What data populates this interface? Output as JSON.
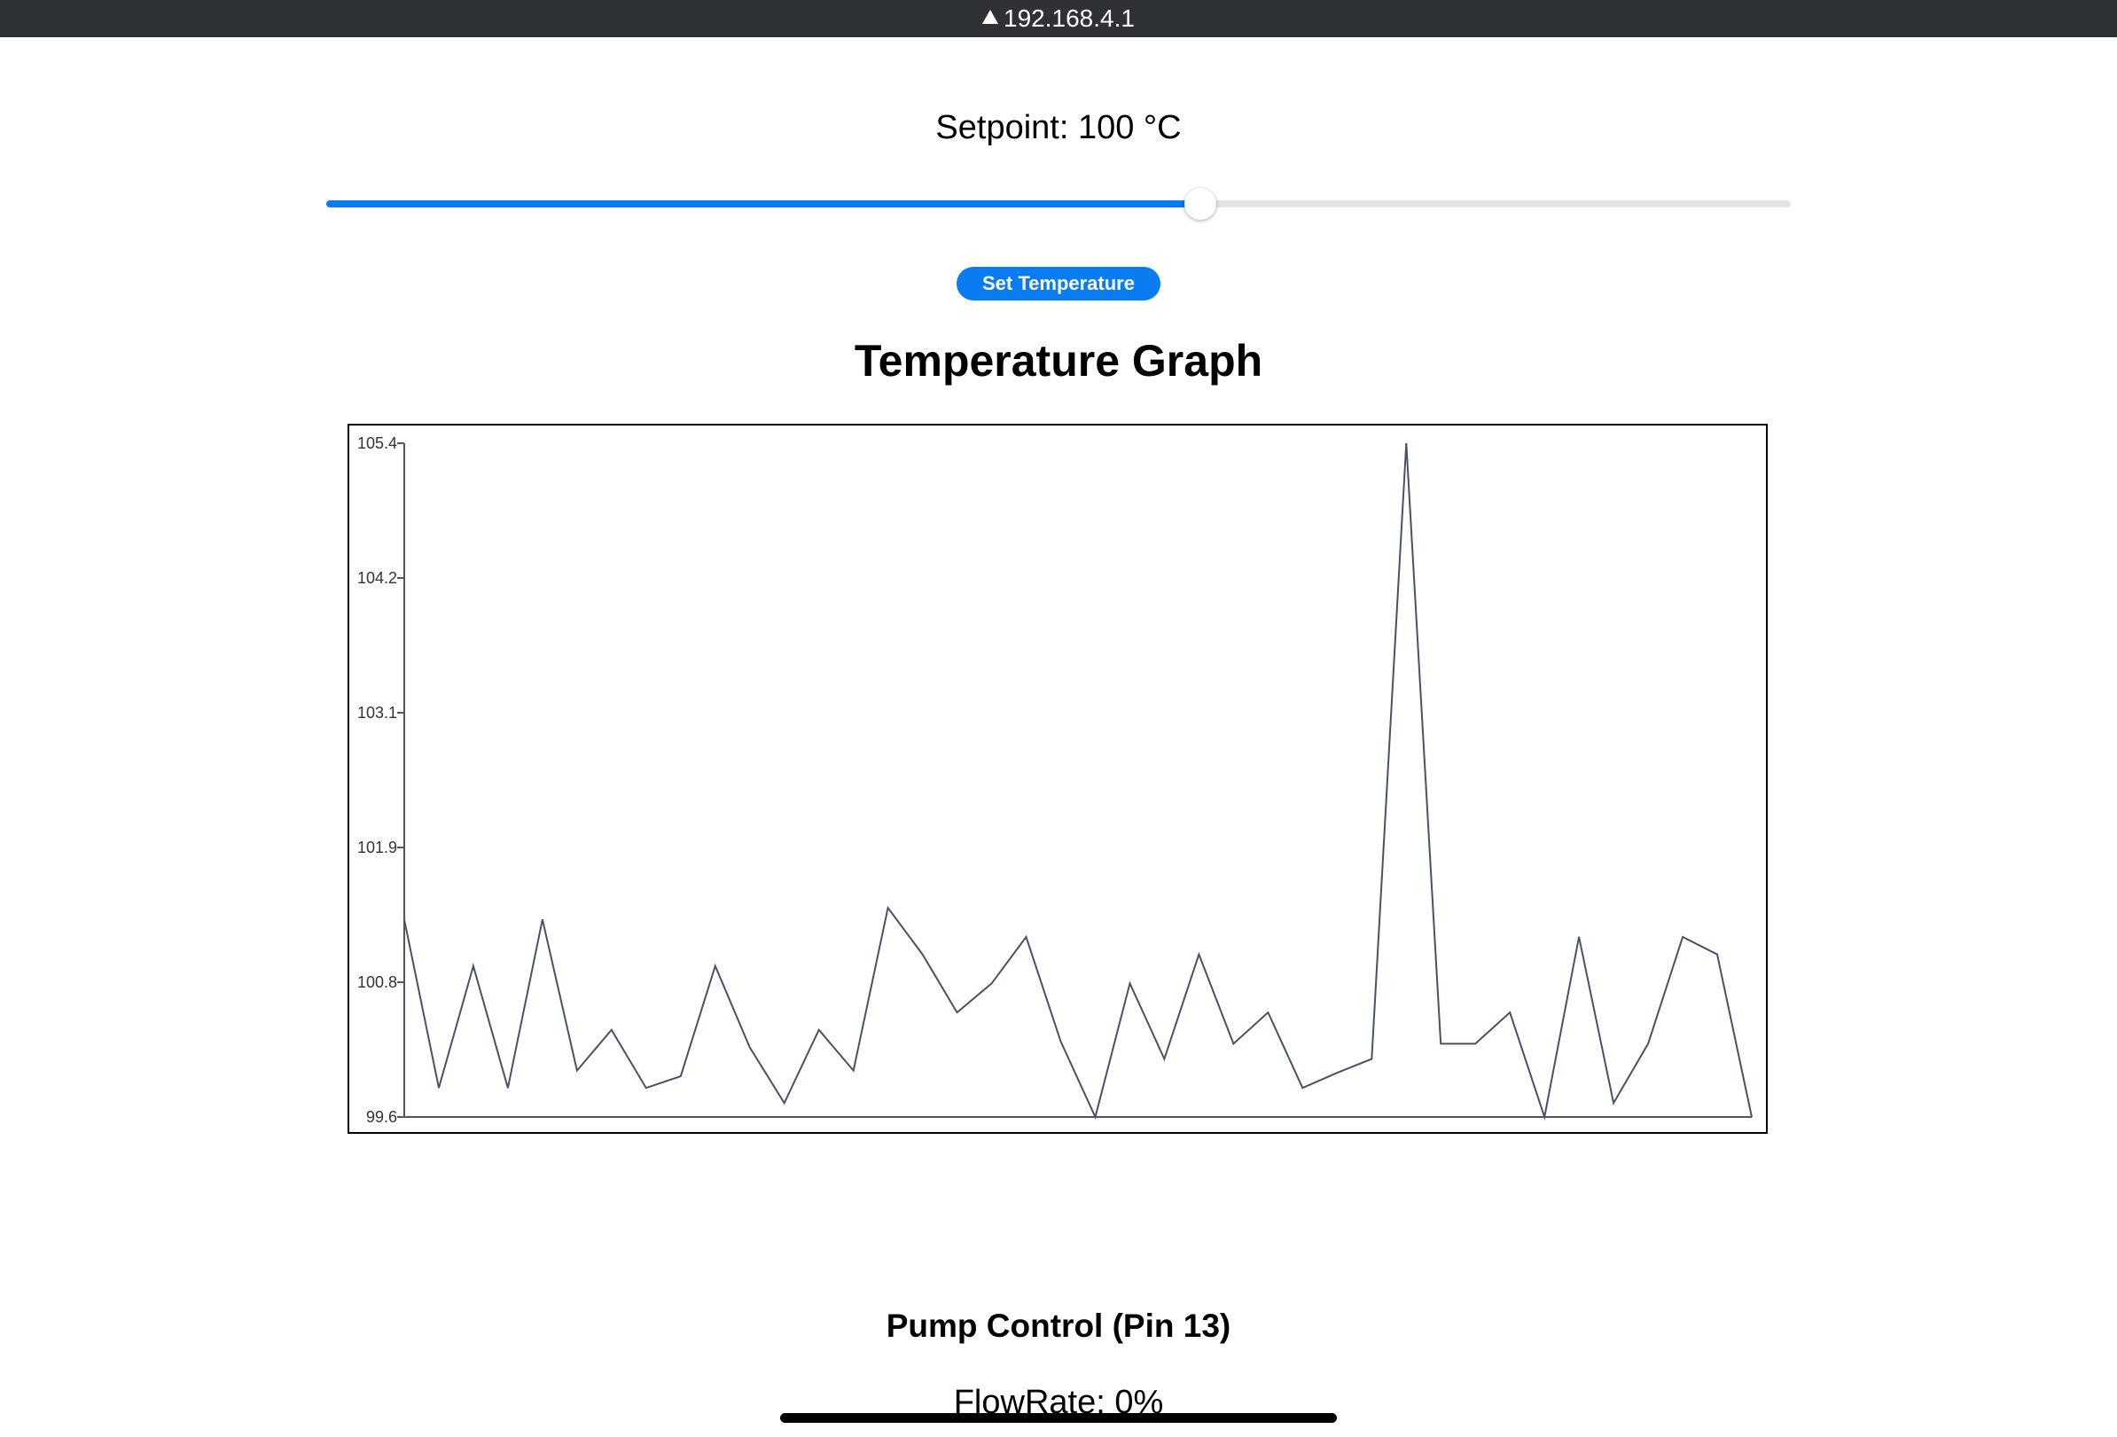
{
  "status_bar": {
    "url": "192.168.4.1",
    "icon": "warning-triangle-icon"
  },
  "setpoint": {
    "label": "Setpoint: 100 °C",
    "slider_fraction": 0.597,
    "slider_color": "#0a7cf2"
  },
  "set_button": {
    "label": "Set Temperature"
  },
  "graph": {
    "title": "Temperature Graph"
  },
  "chart_data": {
    "type": "line",
    "y_ticks": [
      "105.4",
      "104.2",
      "103.1",
      "101.9",
      "100.8",
      "99.6"
    ],
    "ylim": [
      99.6,
      105.4
    ],
    "series": [
      {
        "values": [
          101.3,
          99.85,
          100.9,
          99.85,
          101.3,
          100.0,
          100.35,
          99.85,
          99.95,
          100.9,
          100.2,
          99.72,
          100.35,
          100.0,
          101.4,
          101.0,
          100.5,
          100.75,
          101.15,
          100.25,
          99.6,
          100.75,
          100.1,
          101.0,
          100.23,
          100.5,
          99.85,
          99.98,
          100.1,
          105.4,
          100.23,
          100.23,
          100.5,
          99.6,
          101.15,
          99.72,
          100.23,
          101.15,
          101.0,
          99.6
        ],
        "color": "#4a5068"
      }
    ]
  },
  "pump": {
    "title": "Pump Control (Pin 13)",
    "flow_label": "FlowRate: 0%"
  }
}
